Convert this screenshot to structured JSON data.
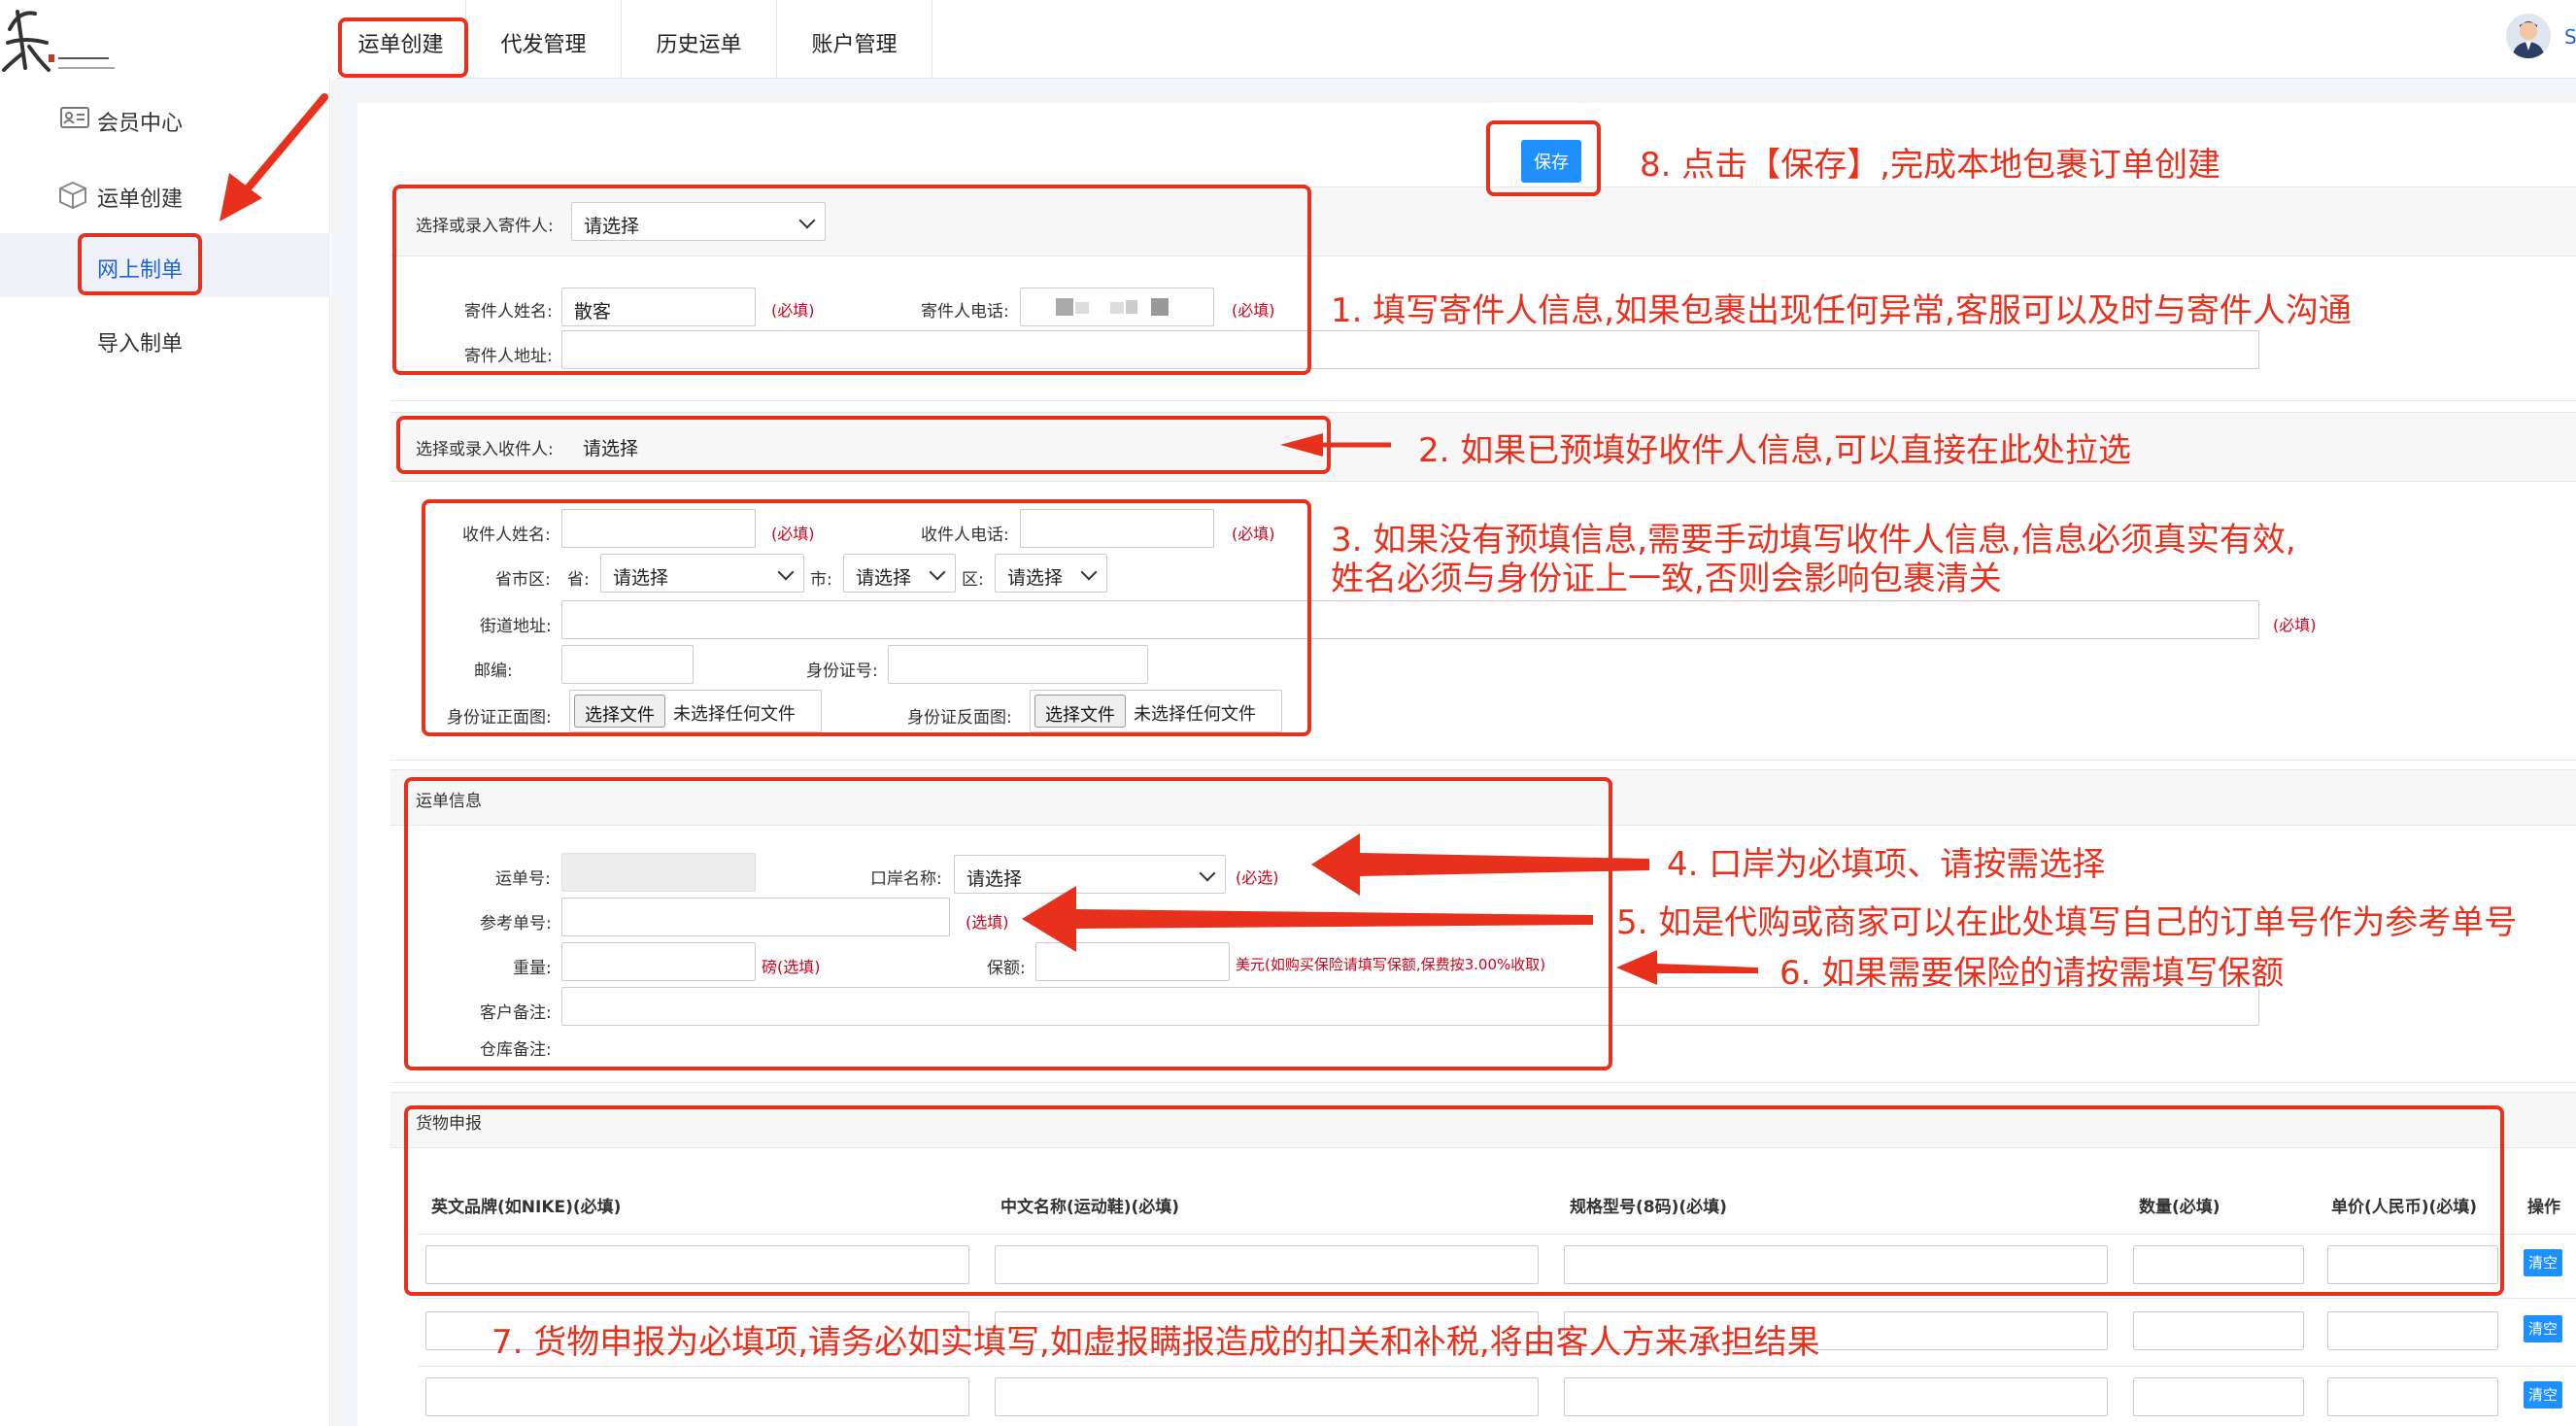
{
  "header": {
    "tabs": [
      {
        "label": "运单创建"
      },
      {
        "label": "代发管理"
      },
      {
        "label": "历史运单"
      },
      {
        "label": "账户管理"
      }
    ],
    "user_initial": "S"
  },
  "sidebar": {
    "member_center": "会员中心",
    "waybill_create": "运单创建",
    "online_order": "网上制单",
    "import_order": "导入制单"
  },
  "toolbar": {
    "save_label": "保存"
  },
  "sender": {
    "select_label": "选择或录入寄件人:",
    "select_value": "请选择",
    "name_label": "寄件人姓名:",
    "name_value": "散客",
    "name_required": "(必填)",
    "phone_label": "寄件人电话:",
    "phone_required": "(必填)",
    "address_label": "寄件人地址:"
  },
  "receiver_select": {
    "label": "选择或录入收件人:",
    "value": "请选择"
  },
  "receiver": {
    "name_label": "收件人姓名:",
    "name_required": "(必填)",
    "phone_label": "收件人电话:",
    "phone_required": "(必填)",
    "region_label": "省市区:",
    "province_label": "省:",
    "province_value": "请选择",
    "city_label": "市:",
    "city_value": "请选择",
    "district_label": "区:",
    "district_value": "请选择",
    "street_label": "街道地址:",
    "street_required": "(必填)",
    "zip_label": "邮编:",
    "id_label": "身份证号:",
    "id_front_label": "身份证正面图:",
    "id_back_label": "身份证反面图:",
    "file_button": "选择文件",
    "file_none": "未选择任何文件"
  },
  "waybill": {
    "section_title": "运单信息",
    "number_label": "运单号:",
    "port_label": "口岸名称:",
    "port_value": "请选择",
    "port_required": "(必选)",
    "ref_label": "参考单号:",
    "ref_optional": "(选填)",
    "weight_label": "重量:",
    "weight_unit": "磅(选填)",
    "insure_label": "保额:",
    "insure_note": "美元(如购买保险请填写保额,保费按3.00%收取)",
    "customer_note_label": "客户备注:",
    "warehouse_note_label": "仓库备注:"
  },
  "goods": {
    "section_title": "货物申报",
    "columns": [
      "英文品牌(如NIKE)(必填)",
      "中文名称(运动鞋)(必填)",
      "规格型号(8码)(必填)",
      "数量(必填)",
      "单价(人民币)(必填)",
      "操作"
    ],
    "clear_label": "清空"
  },
  "annotations": {
    "n1": "1. 填写寄件人信息,如果包裹出现任何异常,客服可以及时与寄件人沟通",
    "n2": "2. 如果已预填好收件人信息,可以直接在此处拉选",
    "n3a": "3. 如果没有预填信息,需要手动填写收件人信息,信息必须真实有效,",
    "n3b": "姓名必须与身份证上一致,否则会影响包裹清关",
    "n4": "4. 口岸为必填项、请按需选择",
    "n5": "5. 如是代购或商家可以在此处填写自己的订单号作为参考单号",
    "n6": "6. 如果需要保险的请按需填写保额",
    "n7": "7. 货物申报为必填项,请务必如实填写,如虚报瞒报造成的扣关和补税,将由客人方来承担结果",
    "n8": "8. 点击【保存】,完成本地包裹订单创建"
  },
  "colors": {
    "annotation_red": "#e8311d",
    "required_red": "#d0021b",
    "primary_blue": "#1e90ff",
    "sidebar_active_text": "#1e63d8"
  }
}
